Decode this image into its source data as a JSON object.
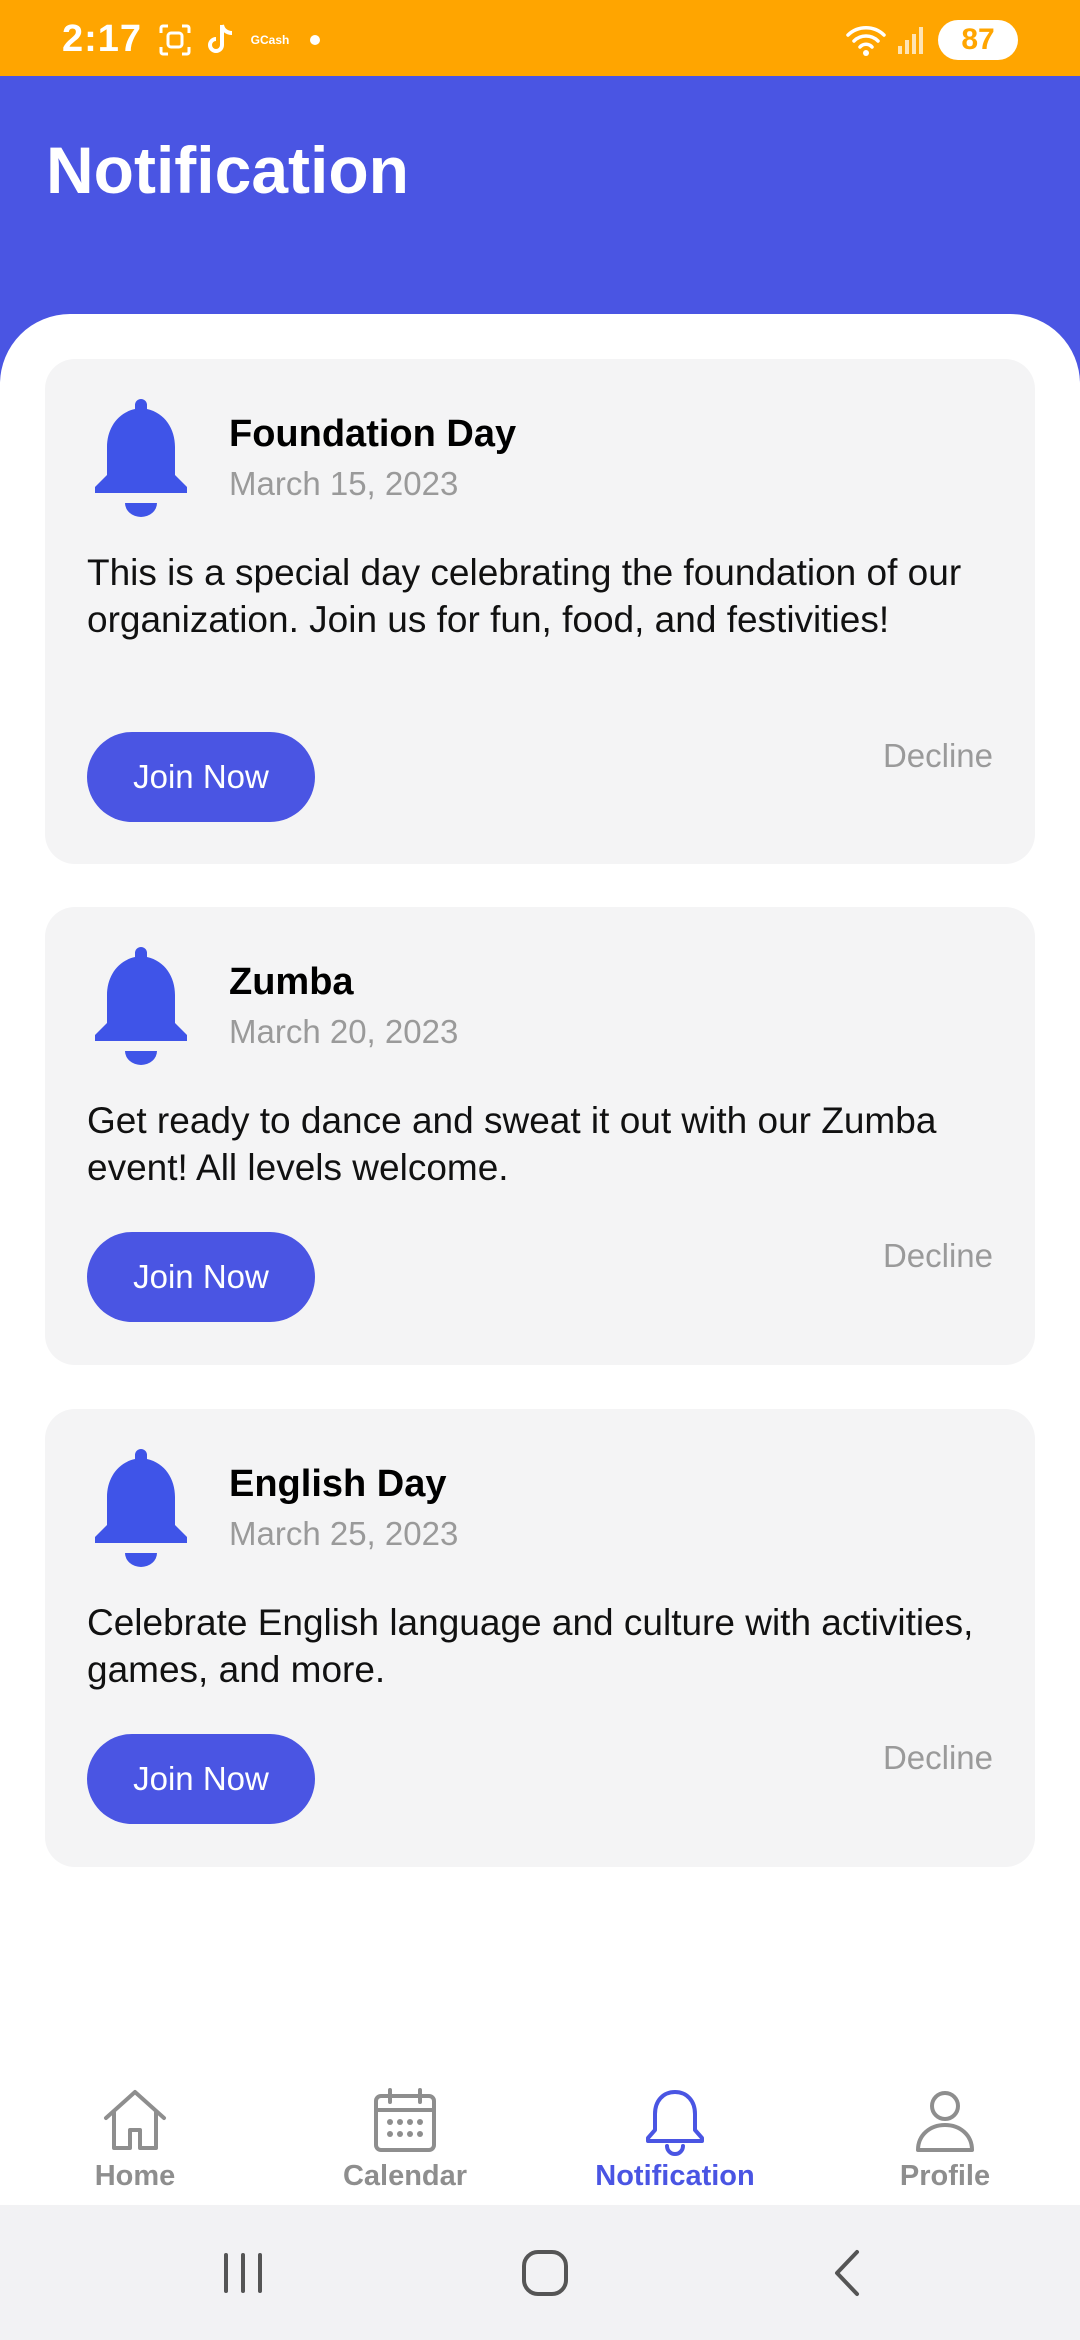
{
  "status_bar": {
    "time": "2:17",
    "gcash_label": "GCash",
    "battery": "87",
    "background_color": "#FFA500"
  },
  "header": {
    "title": "Notification",
    "background_color": "#4A55E3"
  },
  "notifications": [
    {
      "icon": "bell-icon",
      "title": "Foundation Day",
      "date": "March 15, 2023",
      "description": "This is a special day celebrating the foundation of our organization. Join us for fun, food, and festivities!",
      "join_label": "Join Now",
      "decline_label": "Decline"
    },
    {
      "icon": "bell-icon",
      "title": "Zumba",
      "date": "March 20, 2023",
      "description": "Get ready to dance and sweat it out with our Zumba event! All levels welcome.",
      "join_label": "Join Now",
      "decline_label": "Decline"
    },
    {
      "icon": "bell-icon",
      "title": "English Day",
      "date": "March 25, 2023",
      "description": "Celebrate English language and culture with activities, games, and more.",
      "join_label": "Join Now",
      "decline_label": "Decline"
    }
  ],
  "bottom_nav": {
    "items": [
      {
        "label": "Home",
        "icon": "home-icon",
        "active": false
      },
      {
        "label": "Calendar",
        "icon": "calendar-icon",
        "active": false
      },
      {
        "label": "Notification",
        "icon": "bell-icon",
        "active": true
      },
      {
        "label": "Profile",
        "icon": "person-icon",
        "active": false
      }
    ],
    "active_color": "#4A55E3",
    "inactive_color": "#8E8E8E"
  },
  "system_nav": {
    "buttons": [
      "recents-icon",
      "home-circle-icon",
      "back-icon"
    ]
  }
}
